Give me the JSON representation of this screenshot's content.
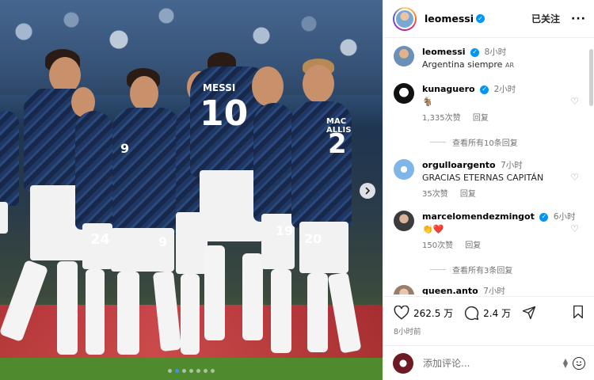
{
  "photo": {
    "jersey_numbers": [
      "10",
      "19",
      "24",
      "9",
      "20",
      "19",
      "2"
    ],
    "back_name_1": "MESSI",
    "back_name_2": "MAC ALLIS",
    "carousel_dot_count": 7,
    "carousel_active_index": 1
  },
  "header": {
    "username": "leomessi",
    "verified_mark": "✓",
    "follow_label": "已关注",
    "more_label": "···"
  },
  "caption": {
    "username": "leomessi",
    "time": "8小时",
    "text": "Argentina siempre",
    "text_suffix": "AR"
  },
  "comments": [
    {
      "username": "kunaguero",
      "time": "2小时",
      "text": "🐐",
      "likes": "1,335次赞",
      "reply_label": "回复",
      "view_replies": "查看所有10条回复"
    },
    {
      "username": "orgulloargento",
      "time": "7小时",
      "text": "GRACIAS ETERNAS CAPITÁN",
      "likes": "35次赞",
      "reply_label": "回复",
      "view_replies": ""
    },
    {
      "username": "marcelomendezmingot",
      "time": "6小时",
      "text": "👏❤️",
      "likes": "150次赞",
      "reply_label": "回复",
      "view_replies": "查看所有3条回复"
    },
    {
      "username": "queen.anto",
      "time": "7小时",
      "text": "",
      "likes": "",
      "reply_label": "",
      "view_replies": ""
    }
  ],
  "actions": {
    "like_count": "262.5 万",
    "comment_count": "2.4 万",
    "post_time": "8小时前"
  },
  "add_comment": {
    "placeholder": "添加评论..."
  }
}
